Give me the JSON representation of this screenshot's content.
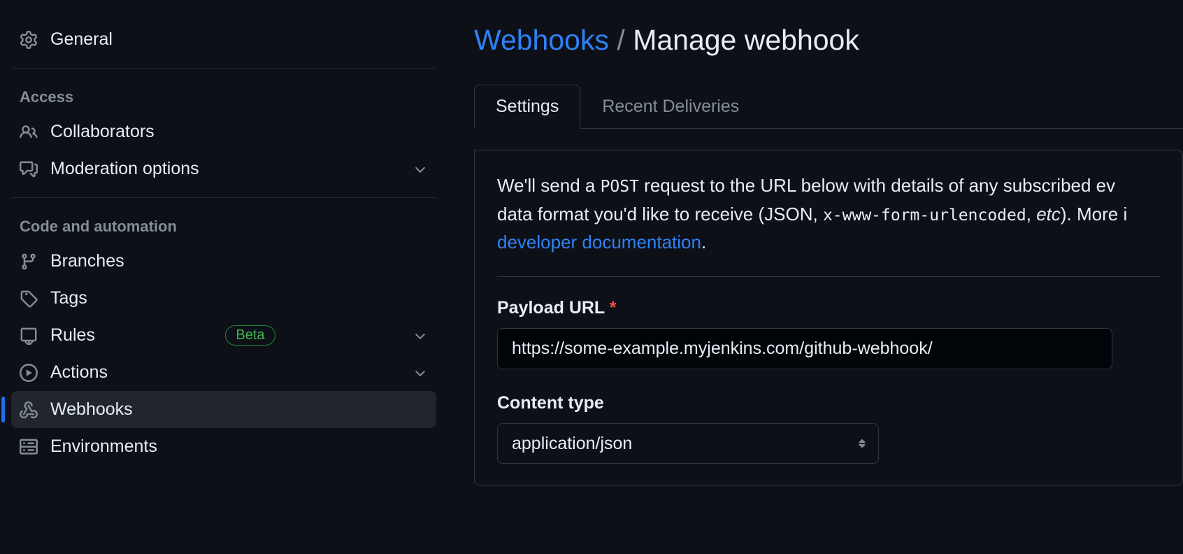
{
  "sidebar": {
    "general": "General",
    "sections": {
      "access_label": "Access",
      "code_label": "Code and automation"
    },
    "items": {
      "collaborators": "Collaborators",
      "moderation": "Moderation options",
      "branches": "Branches",
      "tags": "Tags",
      "rules": "Rules",
      "rules_badge": "Beta",
      "actions": "Actions",
      "webhooks": "Webhooks",
      "environments": "Environments"
    }
  },
  "breadcrumb": {
    "parent": "Webhooks",
    "sep": "/",
    "current": "Manage webhook"
  },
  "tabs": {
    "settings": "Settings",
    "deliveries": "Recent Deliveries"
  },
  "pane": {
    "intro_prefix": "We'll send a ",
    "intro_post": "POST",
    "intro_mid1": " request to the URL below with details of any subscribed ev",
    "intro_mid2": "data format you'd like to receive (JSON, ",
    "intro_enc": "x-www-form-urlencoded",
    "intro_mid3": ", ",
    "intro_etc": "etc",
    "intro_mid4": "). More i",
    "intro_link": "developer documentation",
    "intro_end": ".",
    "payload_label": "Payload URL",
    "payload_value": "https://some-example.myjenkins.com/github-webhook/",
    "content_type_label": "Content type",
    "content_type_value": "application/json"
  }
}
